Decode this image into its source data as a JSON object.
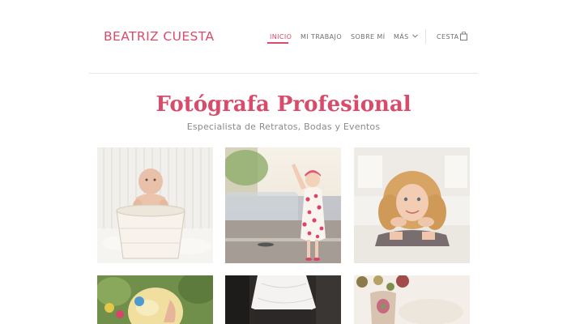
{
  "site": {
    "brand": "BEATRIZ CUESTA"
  },
  "nav": {
    "items": [
      {
        "label": "INICIO",
        "active": true
      },
      {
        "label": "MI TRABAJO",
        "active": false
      },
      {
        "label": "SOBRE MÍ",
        "active": false
      },
      {
        "label": "MÁS",
        "active": false,
        "has_dropdown": true
      }
    ],
    "cart_label": "CESTA",
    "cart_icon": "shopping-bag-icon"
  },
  "hero": {
    "title": "Fotógrafa Profesional",
    "subtitle": "Especialista de Retratos, Bodas y Eventos"
  },
  "gallery": {
    "photos": [
      {
        "subject": "baby in a white bucket"
      },
      {
        "subject": "girl in polka-dot dress waving on a street"
      },
      {
        "subject": "smiling curly-haired girl lying on the floor"
      },
      {
        "subject": "blonde child in a garden"
      },
      {
        "subject": "bride in white dress"
      },
      {
        "subject": "floral vase and tableware"
      }
    ]
  },
  "colors": {
    "accent": "#d94b6a",
    "nav_text": "#6f6f6f",
    "subtitle_text": "#8a8a8a",
    "divider": "#e6e6e6"
  }
}
